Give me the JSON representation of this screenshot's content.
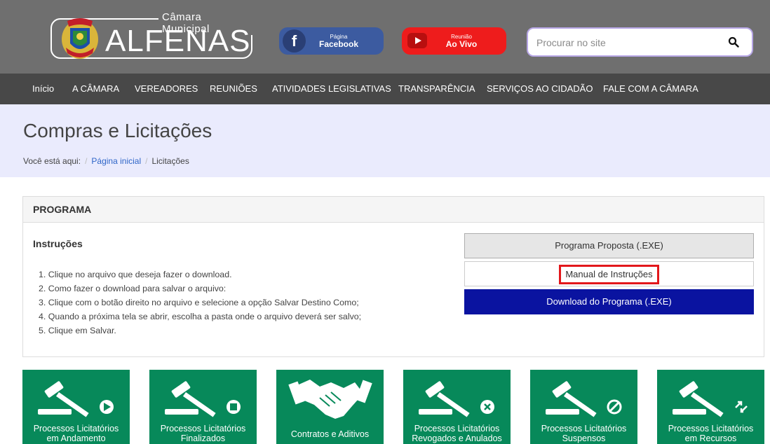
{
  "header": {
    "logo_subtitle": "Câmara Municipal",
    "logo_title": "ALFENAS",
    "facebook_small": "Página",
    "facebook_big": "Facebook",
    "live_small": "Reunião",
    "live_big": "Ao Vivo",
    "search_placeholder": "Procurar no site"
  },
  "nav": {
    "items": [
      {
        "label": "Início"
      },
      {
        "label": "A CÂMARA"
      },
      {
        "label": "VEREADORES"
      },
      {
        "label": "REUNIÕES"
      },
      {
        "label": "ATIVIDADES LEGISLATIVAS"
      },
      {
        "label": "TRANSPARÊNCIA"
      },
      {
        "label": "SERVIÇOS AO CIDADÃO"
      },
      {
        "label": "FALE COM A CÂMARA"
      }
    ]
  },
  "page": {
    "title": "Compras e Licitações",
    "breadcrumb_prefix": "Você está aqui:",
    "breadcrumb_home": "Página inicial",
    "breadcrumb_current": "Licitações"
  },
  "panel": {
    "heading": "PROGRAMA",
    "instructions_title": "Instruções",
    "steps": [
      "1. Clique no arquivo que deseja fazer o download.",
      "2. Como fazer o download para salvar o arquivo:",
      "3. Clique com o botão direito no arquivo e selecione a opção Salvar Destino Como;",
      "4. Quando a próxima tela se abrir, escolha a pasta onde o arquivo deverá ser salvo;",
      "5. Clique em Salvar."
    ],
    "btn_proposta": "Programa Proposta (.EXE)",
    "btn_manual": "Manual de Instruções",
    "btn_download": "Download do Programa (.EXE)"
  },
  "tiles": [
    {
      "line1": "Processos Licitatórios",
      "line2": "em Andamento",
      "icon": "gavel-play-icon"
    },
    {
      "line1": "Processos Licitatórios",
      "line2": "Finalizados",
      "icon": "gavel-stop-icon"
    },
    {
      "line1": "Contratos e Aditivos",
      "line2": "",
      "icon": "handshake-icon"
    },
    {
      "line1": "Processos Licitatórios",
      "line2": "Revogados e Anulados",
      "icon": "gavel-cancel-icon"
    },
    {
      "line1": "Processos Licitatórios",
      "line2": "Suspensos",
      "icon": "gavel-block-icon"
    },
    {
      "line1": "Processos Licitatórios",
      "line2": "em Recursos",
      "icon": "gavel-appeal-icon"
    }
  ],
  "colors": {
    "header_bg": "#6f6f6f",
    "nav_bg": "#484848",
    "title_band_bg": "#eaebfd",
    "tile_green": "#07895a",
    "download_blue": "#0a13a0",
    "highlight_red": "#e2171b",
    "facebook_blue": "#3c5ba0",
    "live_red": "#ee1c1c"
  }
}
